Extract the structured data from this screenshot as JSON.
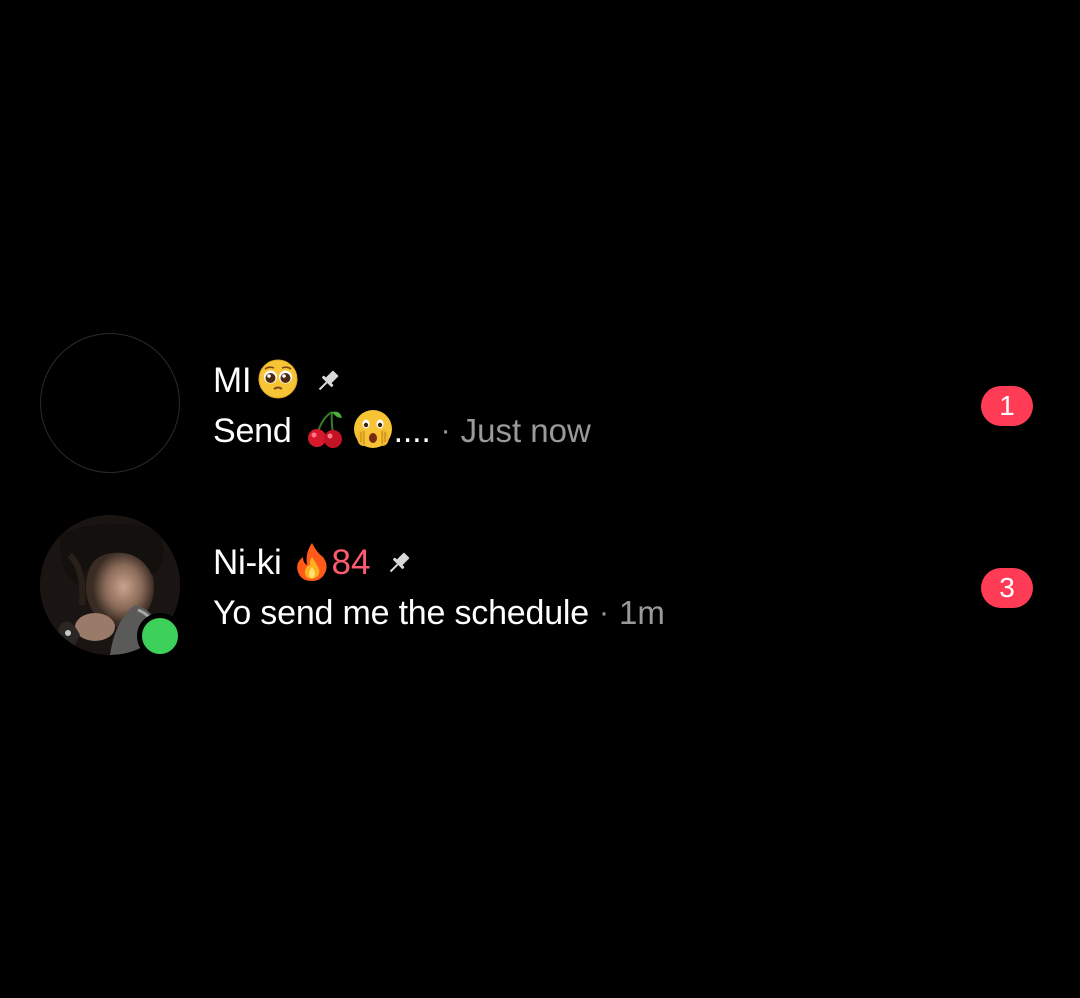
{
  "chats": [
    {
      "name": "MI",
      "name_emoji": "pleading-face",
      "pinned": true,
      "avatar": "empty",
      "preview": "Send",
      "preview_emojis": [
        "cherries",
        "face-with-open-eyes-and-hand-over-mouth"
      ],
      "preview_trailing": "....",
      "separator": "·",
      "timestamp": "Just now",
      "unread_count": "1",
      "online": false
    },
    {
      "name": "Ni-ki",
      "name_emoji": "fire",
      "streak": "84",
      "pinned": true,
      "avatar": "photo",
      "preview": "Yo send me the schedule",
      "separator": "·",
      "timestamp": "1m",
      "unread_count": "3",
      "online": true
    }
  ],
  "colors": {
    "background": "#000000",
    "badge": "#ff3b55",
    "online": "#3dd15a",
    "streak": "#ff5a6e",
    "muted_text": "#9a9a9a"
  }
}
